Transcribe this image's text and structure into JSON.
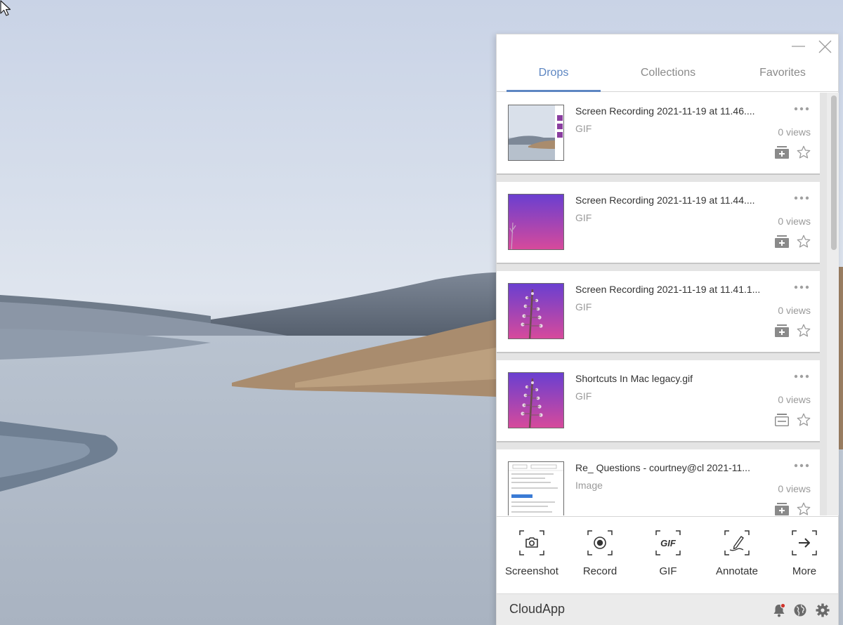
{
  "window": {
    "minimize_icon": "minimize-icon",
    "close_icon": "close-icon"
  },
  "tabs": [
    {
      "label": "Drops",
      "active": true
    },
    {
      "label": "Collections",
      "active": false
    },
    {
      "label": "Favorites",
      "active": false
    }
  ],
  "drops": [
    {
      "title": "Screen Recording 2021-11-19 at 11.46....",
      "type": "GIF",
      "views": "0 views",
      "thumbnail": "landscape-screenshot",
      "collection_icon": "add-to-collection-icon"
    },
    {
      "title": "Screen Recording 2021-11-19 at 11.44....",
      "type": "GIF",
      "views": "0 views",
      "thumbnail": "purple-gradient",
      "collection_icon": "add-to-collection-icon"
    },
    {
      "title": "Screen Recording 2021-11-19 at 11.41.1...",
      "type": "GIF",
      "views": "0 views",
      "thumbnail": "purple-flower",
      "collection_icon": "add-to-collection-icon"
    },
    {
      "title": "Shortcuts In Mac legacy.gif",
      "type": "GIF",
      "views": "0 views",
      "thumbnail": "purple-flower",
      "collection_icon": "in-collection-icon"
    },
    {
      "title": "Re_ Questions - courtney@cl 2021-11...",
      "type": "Image",
      "views": "0 views",
      "thumbnail": "email-screenshot",
      "collection_icon": "add-to-collection-icon"
    }
  ],
  "tools": [
    {
      "label": "Screenshot",
      "icon": "camera-icon"
    },
    {
      "label": "Record",
      "icon": "record-icon"
    },
    {
      "label": "GIF",
      "icon": "gif-icon",
      "icon_text": "GIF"
    },
    {
      "label": "Annotate",
      "icon": "pen-icon"
    },
    {
      "label": "More",
      "icon": "arrow-right-icon"
    }
  ],
  "footer": {
    "brand": "CloudApp",
    "icons": [
      "bell-icon",
      "globe-icon",
      "gear-icon"
    ]
  },
  "colors": {
    "accent": "#5d86c2",
    "notification_dot": "#d0342c"
  }
}
